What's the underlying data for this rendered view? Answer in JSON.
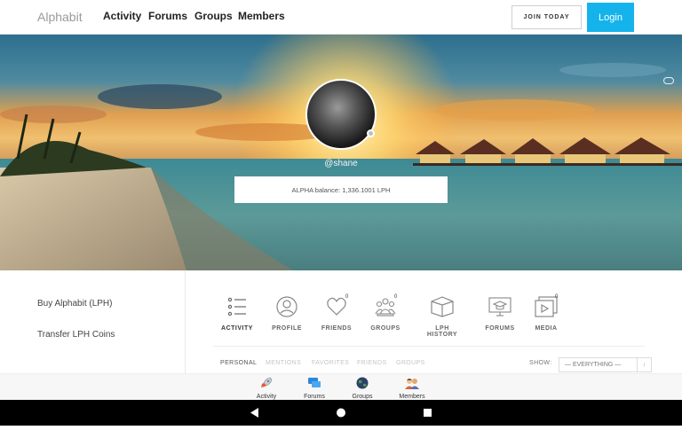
{
  "header": {
    "logo": "Alphabit",
    "nav": [
      "Activity",
      "Forums",
      "Groups",
      "Members"
    ],
    "join_label": "JOIN TODAY",
    "login_label": "Login"
  },
  "profile": {
    "username": "@shane",
    "balance": "ALPHA balance: 1,336.1001 LPH"
  },
  "sidebar": {
    "items": [
      "Buy Alphabit (LPH)",
      "Transfer LPH Coins"
    ]
  },
  "tabs": [
    {
      "label": "ACTIVITY",
      "icon": "activity-list-icon",
      "count": ""
    },
    {
      "label": "PROFILE",
      "icon": "profile-icon",
      "count": ""
    },
    {
      "label": "FRIENDS",
      "icon": "heart-icon",
      "count": "0"
    },
    {
      "label": "GROUPS",
      "icon": "groups-icon",
      "count": "0"
    },
    {
      "label": "LPH HISTORY",
      "icon": "box-icon",
      "count": ""
    },
    {
      "label": "FORUMS",
      "icon": "forums-icon",
      "count": ""
    },
    {
      "label": "MEDIA",
      "icon": "media-icon",
      "count": "0"
    }
  ],
  "subtabs": [
    "PERSONAL",
    "MENTIONS",
    "FAVORITES",
    "FRIENDS",
    "GROUPS"
  ],
  "filter": {
    "show_label": "SHOW:",
    "selected": "— EVERYTHING —"
  },
  "bottom_nav": [
    {
      "label": "Activity",
      "icon": "rocket-icon"
    },
    {
      "label": "Forums",
      "icon": "chat-bubbles-icon"
    },
    {
      "label": "Groups",
      "icon": "globe-icon"
    },
    {
      "label": "Members",
      "icon": "people-icon"
    }
  ],
  "colors": {
    "accent": "#15b3ec",
    "nav_bg": "#000000"
  }
}
